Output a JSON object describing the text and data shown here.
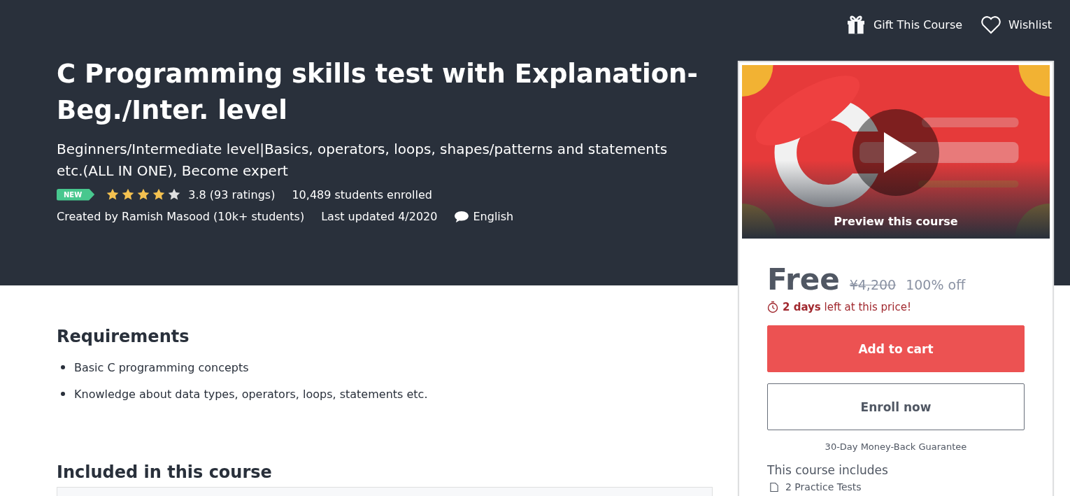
{
  "top_actions": [
    {
      "kind": "gift",
      "label": "Gift This Course"
    },
    {
      "kind": "wishlist",
      "label": "Wishlist"
    }
  ],
  "course": {
    "title": "C Programming skills test with Explanation-Beg./Inter. level",
    "subtitle": "Beginners/Intermediate level|Basics, operators, loops, shapes/patterns and statements etc.(ALL IN ONE), Become expert",
    "badge": "NEW",
    "stars": 4,
    "rating": "3.8 (93 ratings)",
    "enrolled": "10,489 students enrolled",
    "created_by": "Created by Ramish Masood (10k+ students)",
    "last_updated": "Last updated 4/2020",
    "language": "English"
  },
  "requirements": {
    "heading": "Requirements",
    "items": [
      "Basic C programming concepts",
      "Knowledge about data types, operators, loops, statements etc."
    ]
  },
  "included": {
    "heading": "Included in this course"
  },
  "sidebar": {
    "preview": {
      "kind": "picture",
      "label": "Preview this course"
    },
    "price": "Free",
    "original_price": "¥4,200",
    "discount": "100% off",
    "deadline": "**2 days** left at this price!",
    "buttons": [
      {
        "kind": "primary",
        "label": "Add to cart"
      },
      {
        "kind": "secondary",
        "label": "Enroll now"
      }
    ],
    "guarantee": "30-Day Money-Back Guarantee",
    "includes_heading": "This course includes",
    "includes": [
      "2 Practice Tests"
    ]
  }
}
